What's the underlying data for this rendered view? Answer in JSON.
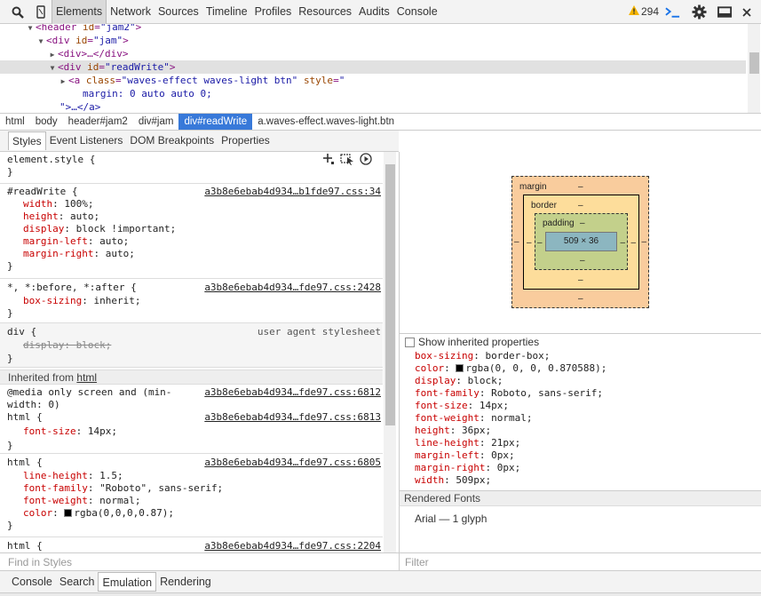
{
  "toolbar": {
    "tabs": [
      "Elements",
      "Network",
      "Sources",
      "Timeline",
      "Profiles",
      "Resources",
      "Audits",
      "Console"
    ],
    "active_tab": "Elements",
    "warning_count": "294"
  },
  "dom_tree": {
    "lines": [
      {
        "open": "<",
        "tag": "header",
        "attr": "id",
        "val": "\"jam2\"",
        "close": ">"
      },
      {
        "open": "<",
        "tag": "div",
        "attr": "id",
        "val": "\"jam\"",
        "close": ">"
      },
      {
        "text": "<div>…</div>"
      },
      {
        "open": "<",
        "tag": "div",
        "attr": "id",
        "val": "\"readWrite\"",
        "close": ">"
      },
      {
        "open": "<",
        "tag": "a",
        "attr": "class",
        "val": "\"waves-effect waves-light btn\"",
        "attr2": "style",
        "val2": "\""
      },
      {
        "text": "margin: 0 auto auto 0;"
      },
      {
        "text": "\">…</a>"
      }
    ]
  },
  "breadcrumbs": [
    "html",
    "body",
    "header#jam2",
    "div#jam",
    "div#readWrite",
    "a.waves-effect.waves-light.btn"
  ],
  "subtabs": [
    "Styles",
    "Event Listeners",
    "DOM Breakpoints",
    "Properties"
  ],
  "styles": {
    "element_style": {
      "selector": "element.style {",
      "close": "}"
    },
    "rule1": {
      "selector": "#readWrite {",
      "source": "a3b8e6ebab4d934…b1fde97.css:34",
      "props": [
        {
          "name": "width",
          "value": "100%;"
        },
        {
          "name": "height",
          "value": "auto;"
        },
        {
          "name": "display",
          "value": "block !important;"
        },
        {
          "name": "margin-left",
          "value": "auto;"
        },
        {
          "name": "margin-right",
          "value": "auto;"
        }
      ]
    },
    "rule2": {
      "selector": "*, *:before, *:after {",
      "source": "a3b8e6ebab4d934…fde97.css:2428",
      "props": [
        {
          "name": "box-sizing",
          "value": "inherit;"
        }
      ]
    },
    "rule3": {
      "selector": "div {",
      "source": "user agent stylesheet",
      "props": [
        {
          "name": "display",
          "value": "block;"
        }
      ]
    },
    "inherited_label": "Inherited from",
    "inherited_from": "html",
    "rule4": {
      "selector_line1": "@media only screen and (min-",
      "selector_line2": "width: 0)",
      "source_media": "a3b8e6ebab4d934…fde97.css:6812",
      "selector": "html {",
      "source": "a3b8e6ebab4d934…fde97.css:6813",
      "props": [
        {
          "name": "font-size",
          "value": "14px;"
        }
      ]
    },
    "rule5": {
      "selector": "html {",
      "source": "a3b8e6ebab4d934…fde97.css:6805",
      "props": [
        {
          "name": "line-height",
          "value": "1.5;"
        },
        {
          "name": "font-family",
          "value": "\"Roboto\", sans-serif;"
        },
        {
          "name": "font-weight",
          "value": "normal;"
        },
        {
          "name": "color",
          "value": "rgba(0,0,0,0.87);"
        }
      ]
    },
    "rule6": {
      "selector": "html {",
      "source": "a3b8e6ebab4d934…fde97.css:2204"
    }
  },
  "metrics": {
    "margin_label": "margin",
    "border_label": "border",
    "padding_label": "padding",
    "content": "509 × 36",
    "dash": "–"
  },
  "computed": {
    "show_inherited": "Show inherited properties",
    "props": [
      {
        "name": "box-sizing",
        "value": "border-box;"
      },
      {
        "name": "color",
        "value": "rgba(0, 0, 0, 0.870588);",
        "swatch": true
      },
      {
        "name": "display",
        "value": "block;"
      },
      {
        "name": "font-family",
        "value": "Roboto, sans-serif;"
      },
      {
        "name": "font-size",
        "value": "14px;"
      },
      {
        "name": "font-weight",
        "value": "normal;"
      },
      {
        "name": "height",
        "value": "36px;"
      },
      {
        "name": "line-height",
        "value": "21px;"
      },
      {
        "name": "margin-left",
        "value": "0px;"
      },
      {
        "name": "margin-right",
        "value": "0px;"
      },
      {
        "name": "width",
        "value": "509px;"
      }
    ]
  },
  "rendered_fonts": {
    "header": "Rendered Fonts",
    "line": "Arial — 1 glyph"
  },
  "find_styles_placeholder": "Find in Styles",
  "filter_placeholder": "Filter",
  "drawer_tabs": [
    "Console",
    "Search",
    "Emulation",
    "Rendering"
  ],
  "active_drawer_tab": "Emulation",
  "colors": {
    "accent": "#3879d9",
    "prop": "#c80000",
    "tag": "#881280"
  }
}
